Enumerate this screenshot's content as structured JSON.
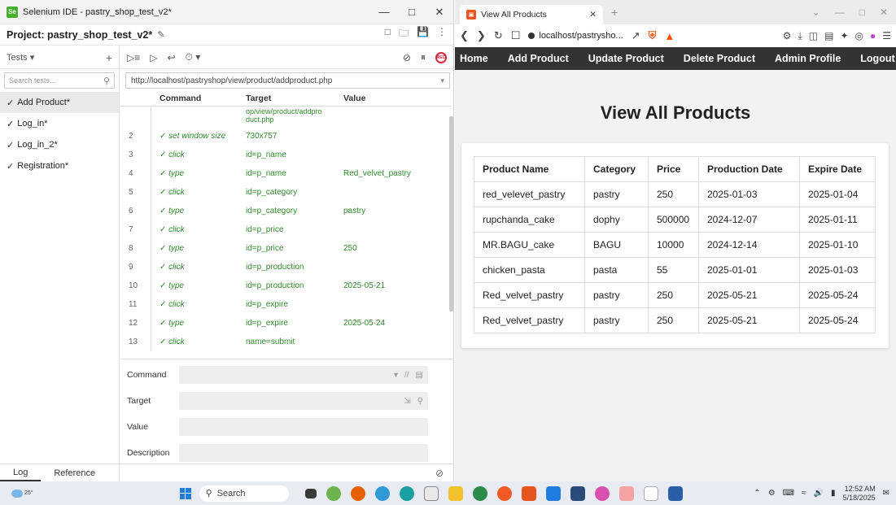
{
  "ide": {
    "window_title": "Selenium IDE - pastry_shop_test_v2*",
    "app_icon_text": "Se",
    "project_title": "Project:  pastry_shop_test_v2*",
    "tests_label": "Tests",
    "search_placeholder": "Search tests...",
    "tests": [
      {
        "name": "Add Product*"
      },
      {
        "name": "Log_in*"
      },
      {
        "name": "Log_in_2*"
      },
      {
        "name": "Registration*"
      }
    ],
    "rec_label": "REC",
    "base_url": "http://localhost/pastryshop/view/product/addproduct.php",
    "columns": {
      "command": "Command",
      "target": "Target",
      "value": "Value"
    },
    "first_row_target": "op/view/product/addpro duct.php",
    "commands": [
      {
        "num": "2",
        "command": "set window size",
        "target": "730x757",
        "value": ""
      },
      {
        "num": "3",
        "command": "click",
        "target": "id=p_name",
        "value": ""
      },
      {
        "num": "4",
        "command": "type",
        "target": "id=p_name",
        "value": "Red_velvet_pastry"
      },
      {
        "num": "5",
        "command": "click",
        "target": "id=p_category",
        "value": ""
      },
      {
        "num": "6",
        "command": "type",
        "target": "id=p_category",
        "value": "pastry"
      },
      {
        "num": "7",
        "command": "click",
        "target": "id=p_price",
        "value": ""
      },
      {
        "num": "8",
        "command": "type",
        "target": "id=p_price",
        "value": "250"
      },
      {
        "num": "9",
        "command": "click",
        "target": "id=p_production",
        "value": ""
      },
      {
        "num": "10",
        "command": "type",
        "target": "id=p_production",
        "value": "2025-05-21"
      },
      {
        "num": "11",
        "command": "click",
        "target": "id=p_expire",
        "value": ""
      },
      {
        "num": "12",
        "command": "type",
        "target": "id=p_expire",
        "value": "2025-05-24"
      },
      {
        "num": "13",
        "command": "click",
        "target": "name=submit",
        "value": ""
      }
    ],
    "editor": {
      "command_label": "Command",
      "target_label": "Target",
      "value_label": "Value",
      "description_label": "Description",
      "comment_btn": "//"
    },
    "bottom_tabs": {
      "log": "Log",
      "reference": "Reference"
    }
  },
  "browser": {
    "tab_title": "View All Products",
    "url": "localhost/pastrysho...",
    "nav": [
      "Home",
      "Add Product",
      "Update Product",
      "Delete Product",
      "Admin Profile",
      "Logout"
    ],
    "page_title": "View All Products",
    "table": {
      "headers": [
        "Product Name",
        "Category",
        "Price",
        "Production Date",
        "Expire Date"
      ],
      "rows": [
        [
          "red_velevet_pastry",
          "pastry",
          "250",
          "2025-01-03",
          "2025-01-04"
        ],
        [
          "rupchanda_cake",
          "dophy",
          "500000",
          "2024-12-07",
          "2025-01-11"
        ],
        [
          "MR.BAGU_cake",
          "BAGU",
          "10000",
          "2024-12-14",
          "2025-01-10"
        ],
        [
          "chicken_pasta",
          "pasta",
          "55",
          "2025-01-01",
          "2025-01-03"
        ],
        [
          "Red_velvet_pastry",
          "pastry",
          "250",
          "2025-05-21",
          "2025-05-24"
        ],
        [
          "Red_velvet_pastry",
          "pastry",
          "250",
          "2025-05-21",
          "2025-05-24"
        ]
      ]
    }
  },
  "taskbar": {
    "weather": "25°",
    "search_label": "Search",
    "time": "12:52 AM",
    "date": "5/18/2025"
  },
  "colors": {
    "command_green": "#2f8a2b",
    "nav_bg": "#333333",
    "rec_red": "#d9263a"
  }
}
